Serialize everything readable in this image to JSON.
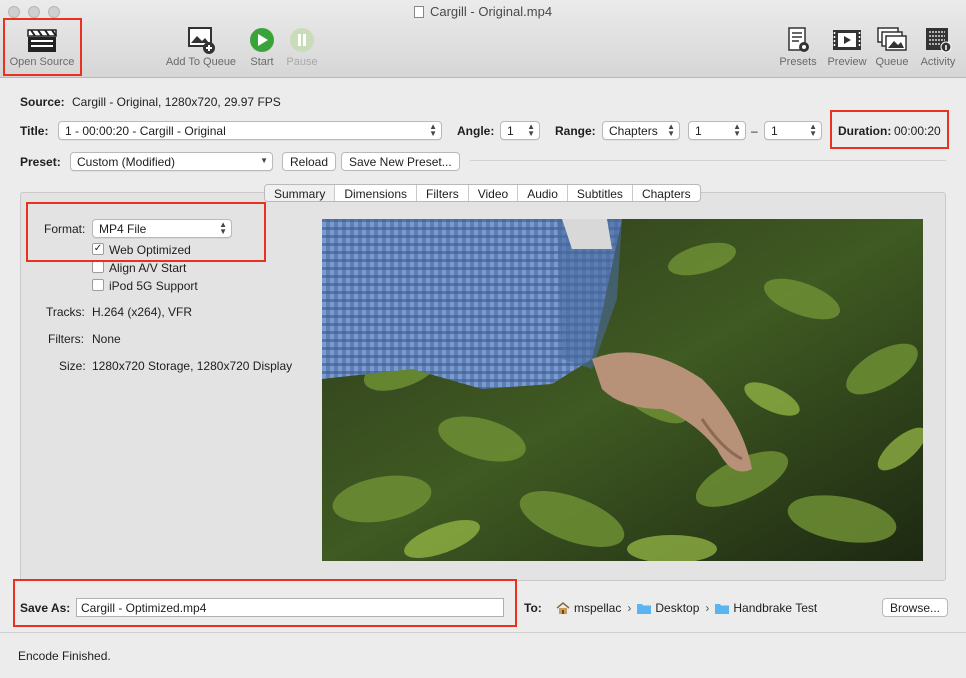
{
  "window": {
    "title": "Cargill - Original.mp4"
  },
  "toolbar": {
    "open_source": "Open Source",
    "add_to_queue": "Add To Queue",
    "start": "Start",
    "pause": "Pause",
    "presets": "Presets",
    "preview": "Preview",
    "queue": "Queue",
    "activity": "Activity"
  },
  "source": {
    "label": "Source:",
    "value": "Cargill - Original, 1280x720, 29.97 FPS"
  },
  "title_row": {
    "title_label": "Title:",
    "title_value": "1 - 00:00:20 - Cargill - Original",
    "angle_label": "Angle:",
    "angle_value": "1",
    "range_label": "Range:",
    "range_mode": "Chapters",
    "range_start": "1",
    "range_dash": "–",
    "range_end": "1",
    "duration_label": "Duration:",
    "duration_value": "00:00:20"
  },
  "preset_row": {
    "label": "Preset:",
    "value": "Custom (Modified)",
    "reload": "Reload",
    "save_new": "Save New Preset..."
  },
  "tabs": [
    "Summary",
    "Dimensions",
    "Filters",
    "Video",
    "Audio",
    "Subtitles",
    "Chapters"
  ],
  "summary": {
    "format_label": "Format:",
    "format_value": "MP4 File",
    "web_optimized": "Web Optimized",
    "web_optimized_checked": true,
    "align_av": "Align A/V Start",
    "align_av_checked": false,
    "ipod": "iPod 5G Support",
    "ipod_checked": false,
    "tracks_label": "Tracks:",
    "tracks_value": "H.264 (x264), VFR",
    "filters_label": "Filters:",
    "filters_value": "None",
    "size_label": "Size:",
    "size_value": "1280x720 Storage, 1280x720 Display"
  },
  "save_row": {
    "label": "Save As:",
    "value": "Cargill - Optimized.mp4",
    "to_label": "To:",
    "path": [
      "mspellac",
      "Desktop",
      "Handbrake Test"
    ],
    "separator": "›",
    "browse": "Browse..."
  },
  "status": {
    "text": "Encode Finished."
  },
  "colors": {
    "highlight": "#e8321f",
    "start_green": "#3aa33a",
    "folder_blue": "#59b4f0"
  }
}
